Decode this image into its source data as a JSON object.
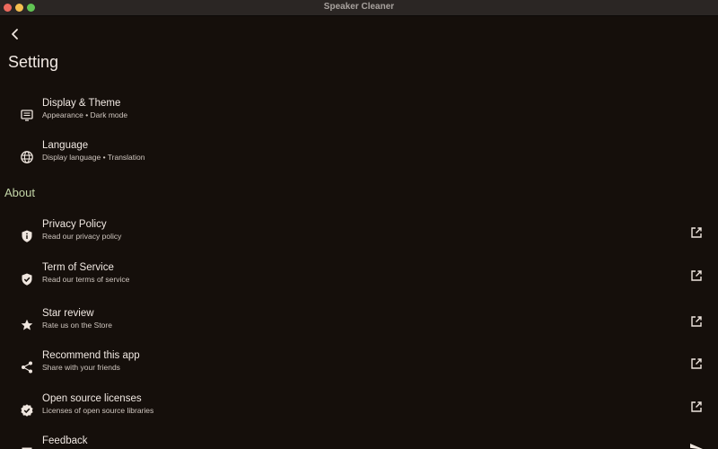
{
  "window": {
    "title": "Speaker Cleaner"
  },
  "header": {
    "title": "Setting"
  },
  "general_items": [
    {
      "label": "Display & Theme",
      "sub": "Appearance • Dark mode",
      "icon": "display-icon"
    },
    {
      "label": "Language",
      "sub": "Display language • Translation",
      "icon": "globe-icon"
    }
  ],
  "about": {
    "header": "About",
    "items": [
      {
        "label": "Privacy Policy",
        "sub": "Read our privacy policy",
        "icon": "shield-info-icon"
      },
      {
        "label": "Term of Service",
        "sub": "Read our terms of service",
        "icon": "shield-check-icon"
      },
      {
        "label": "Star review",
        "sub": "Rate us on the Store",
        "icon": "star-icon"
      },
      {
        "label": "Recommend this app",
        "sub": "Share with your friends",
        "icon": "share-icon"
      },
      {
        "label": "Open source licenses",
        "sub": "Licenses of open source libraries",
        "icon": "verified-icon"
      },
      {
        "label": "Feedback",
        "sub": "",
        "icon": "feedback-icon"
      }
    ]
  },
  "colors": {
    "background": "#150f0b",
    "accent": "#c4d6a8",
    "text": "#f1e9e3"
  }
}
